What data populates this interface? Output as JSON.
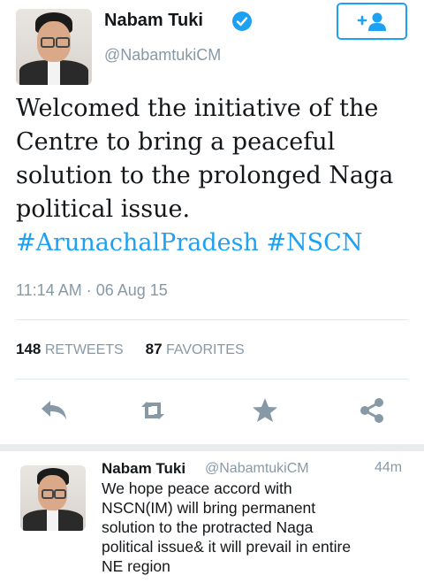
{
  "tweet": {
    "display_name": "Nabam Tuki",
    "handle": "@NabamtukiCM",
    "text_line1": "Welcomed the initiative of the",
    "text_line2": "Centre to bring a peaceful",
    "text_line3": "solution to the prolonged Naga",
    "text_line4": "political issue.",
    "hashtag1": "#ArunachalPradesh",
    "hashtag2": "#NSCN",
    "timestamp": "11:14 AM · 06 Aug 15",
    "retweets_count": "148",
    "retweets_label": "RETWEETS",
    "favorites_count": "87",
    "favorites_label": "FAVORITES"
  },
  "icons": {
    "verified": "verified-badge-icon",
    "follow": "add-user-icon",
    "reply": "reply-icon",
    "retweet": "retweet-icon",
    "favorite": "star-icon",
    "share": "share-icon"
  },
  "reply_tweet": {
    "display_name": "Nabam Tuki",
    "handle": "@NabamtukiCM",
    "time": "44m",
    "text_line1": "We hope peace accord with",
    "text_line2": "NSCN(IM) will bring permanent",
    "text_line3": "solution to the protracted Naga",
    "text_line4": "political issue& it will prevail in entire",
    "text_line5": "NE region"
  },
  "colors": {
    "accent": "#1da1f2",
    "muted": "#8899a6",
    "text": "#14171a",
    "action_icon": "#8899a6"
  }
}
